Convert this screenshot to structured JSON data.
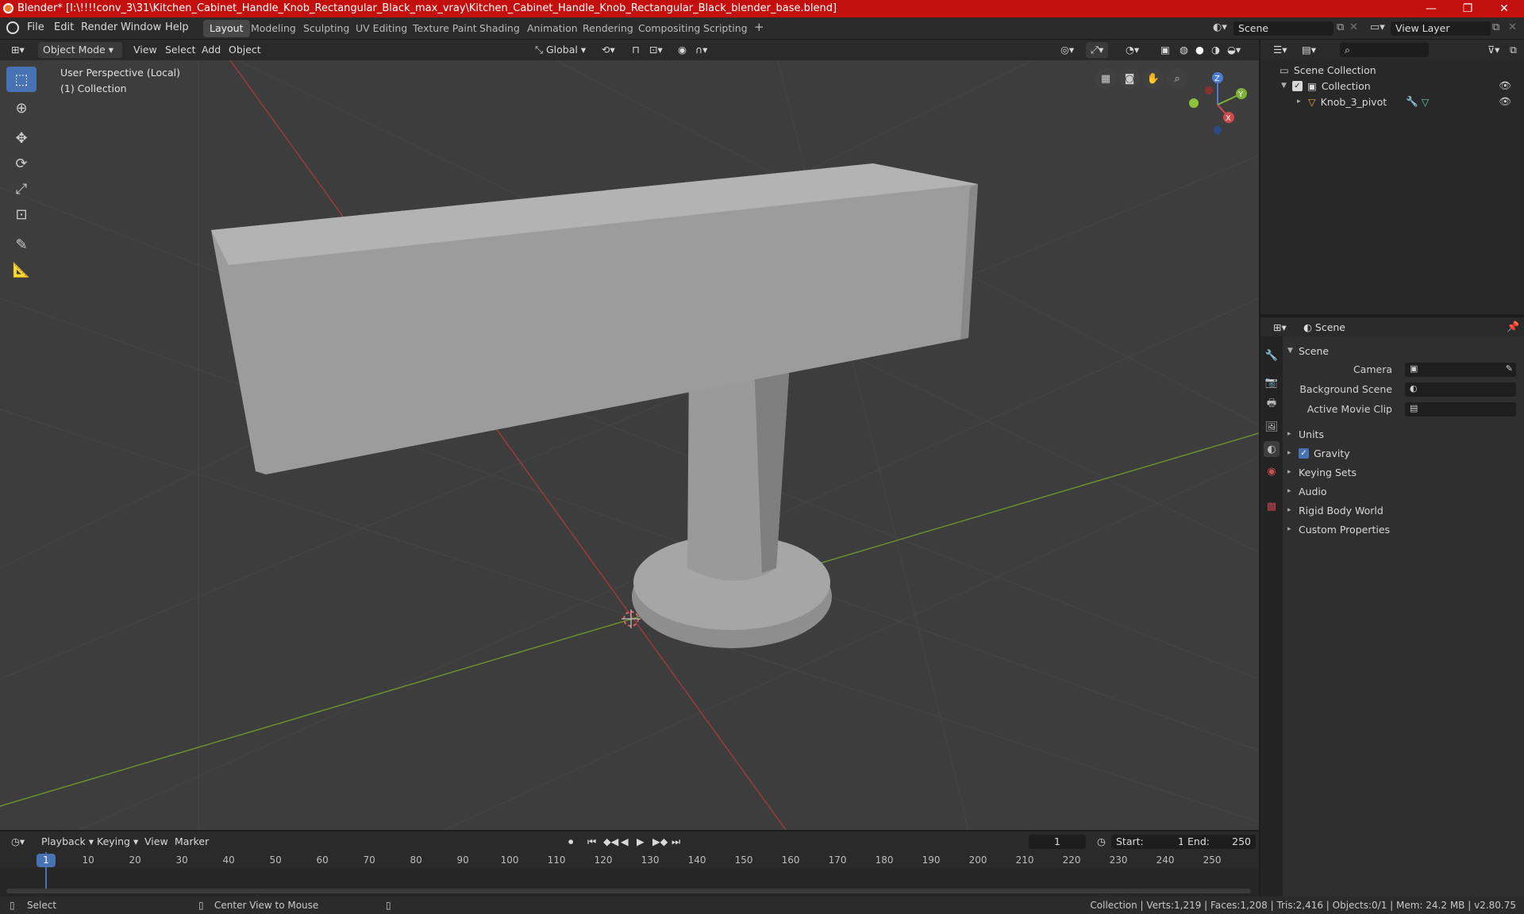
{
  "titlebar": {
    "title": "Blender* [I:\\!!!!conv_3\\31\\Kitchen_Cabinet_Handle_Knob_Rectangular_Black_max_vray\\Kitchen_Cabinet_Handle_Knob_Rectangular_Black_blender_base.blend]",
    "minimize": "—",
    "maximize": "❐",
    "close": "✕"
  },
  "menubar": {
    "menus": [
      "File",
      "Edit",
      "Render",
      "Window",
      "Help"
    ],
    "workspaces": [
      "Layout",
      "Modeling",
      "Sculpting",
      "UV Editing",
      "Texture Paint",
      "Shading",
      "Animation",
      "Rendering",
      "Compositing",
      "Scripting"
    ],
    "add_workspace": "+",
    "scene_name": "Scene",
    "view_layer": "View Layer"
  },
  "viewport_header": {
    "mode": "Object Mode",
    "menus": [
      "View",
      "Select",
      "Add",
      "Object"
    ],
    "transform_orientation": "Global"
  },
  "viewport": {
    "perspective_label": "User Perspective (Local)",
    "collection_label": "(1) Collection",
    "gizmo_axes": {
      "x": "X",
      "y": "Y",
      "z": "Z"
    }
  },
  "outliner": {
    "search_placeholder": "",
    "root": "Scene Collection",
    "collection": "Collection",
    "object": "Knob_3_pivot"
  },
  "properties": {
    "header_title": "Scene",
    "panel_title": "Scene",
    "camera_label": "Camera",
    "background_scene_label": "Background Scene",
    "active_movie_clip_label": "Active Movie Clip",
    "sections": [
      "Units",
      "Gravity",
      "Keying Sets",
      "Audio",
      "Rigid Body World",
      "Custom Properties"
    ],
    "gravity_checked": true
  },
  "timeline": {
    "menus": [
      "Playback",
      "Keying",
      "View",
      "Marker"
    ],
    "current_frame": "1",
    "start_label": "Start:",
    "start_value": "1",
    "end_label": "End:",
    "end_value": "250",
    "ticks": [
      "1",
      "10",
      "20",
      "30",
      "40",
      "50",
      "60",
      "70",
      "80",
      "90",
      "100",
      "110",
      "120",
      "130",
      "140",
      "150",
      "160",
      "170",
      "180",
      "190",
      "200",
      "210",
      "220",
      "230",
      "240",
      "250"
    ]
  },
  "statusbar": {
    "select": "Select",
    "center_view": "Center View to Mouse",
    "stats": "Collection | Verts:1,219 | Faces:1,208 | Tris:2,416 | Objects:0/1 | Mem: 24.2 MB | v2.80.75"
  },
  "colors": {
    "titlebar": "#c40f0f",
    "accent": "#4772b3",
    "viewport_bg": "#3d3d3d",
    "x_axis": "#d04a4a",
    "y_axis": "#7fb03a"
  }
}
